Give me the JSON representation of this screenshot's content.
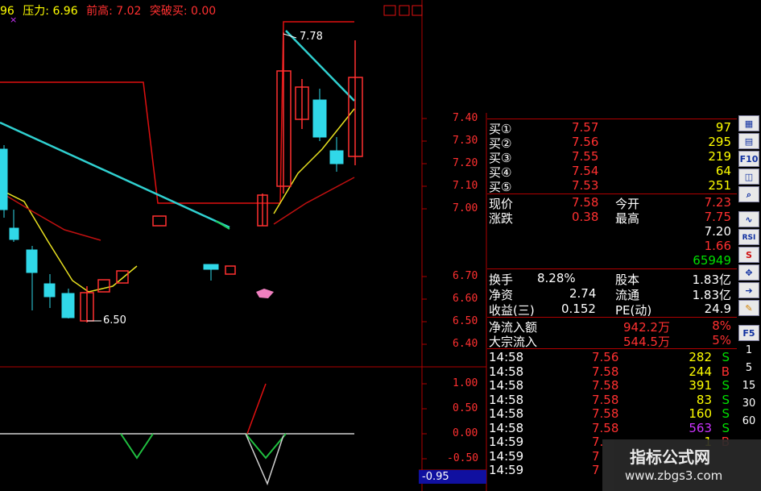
{
  "header": {
    "prefix": "96",
    "pressure": "压力: 6.96",
    "prev_high": "前高: 7.02",
    "breakout": "突破买: 0.00",
    "close_mark": "×"
  },
  "price_axis": [
    "7.40",
    "7.30",
    "7.20",
    "7.10",
    "7.00",
    "6.70",
    "6.60",
    "6.50",
    "6.40"
  ],
  "indicator_axis": [
    "1.00",
    "0.50",
    "0.00",
    "-0.50"
  ],
  "indicator_value": "-0.95",
  "annotations": {
    "high": "7.78",
    "low": "6.50"
  },
  "bids": [
    {
      "label": "买①",
      "price": "7.57",
      "vol": "97"
    },
    {
      "label": "买②",
      "price": "7.56",
      "vol": "295"
    },
    {
      "label": "买③",
      "price": "7.55",
      "vol": "219"
    },
    {
      "label": "买④",
      "price": "7.54",
      "vol": "64"
    },
    {
      "label": "买⑤",
      "price": "7.53",
      "vol": "251"
    }
  ],
  "quote": {
    "cur_label": "现价",
    "cur": "7.58",
    "open_label": "今开",
    "open": "7.23",
    "chg_label": "涨跌",
    "chg": "0.38",
    "high_label": "最高",
    "high": "7.75",
    "low": "7.20",
    "amp": "1.66",
    "vol": "65949"
  },
  "fund": {
    "turn_label": "换手",
    "turn": "8.28%",
    "cap_label": "股本",
    "cap": "1.83亿",
    "net_label": "净资",
    "net": "2.74",
    "float_label": "流通",
    "float": "1.83亿",
    "eps_label": "收益(三)",
    "eps": "0.152",
    "pe_label": "PE(动)",
    "pe": "24.9"
  },
  "flows": [
    {
      "label": "净流入额",
      "val": "942.2万",
      "pct": "8%"
    },
    {
      "label": "大宗流入",
      "val": "544.5万",
      "pct": "5%"
    }
  ],
  "ticks": [
    {
      "t": "14:58",
      "p": "7.56",
      "v": "282",
      "d": "S"
    },
    {
      "t": "14:58",
      "p": "7.58",
      "v": "244",
      "d": "B"
    },
    {
      "t": "14:58",
      "p": "7.58",
      "v": "391",
      "d": "S"
    },
    {
      "t": "14:58",
      "p": "7.58",
      "v": "83",
      "d": "S"
    },
    {
      "t": "14:58",
      "p": "7.58",
      "v": "160",
      "d": "S"
    },
    {
      "t": "14:58",
      "p": "7.58",
      "v": "563",
      "d": "S"
    },
    {
      "t": "14:59",
      "p": "7.",
      "v": "1",
      "d": "B"
    },
    {
      "t": "14:59",
      "p": "7",
      "v": "",
      "d": ""
    },
    {
      "t": "14:59",
      "p": "7",
      "v": "",
      "d": ""
    }
  ],
  "toolbar": [
    "F10",
    "RSI",
    "F5",
    "1",
    "5",
    "15",
    "30",
    "60"
  ],
  "watermark": {
    "title": "指标公式网",
    "url": "www.zbgs3.com"
  }
}
